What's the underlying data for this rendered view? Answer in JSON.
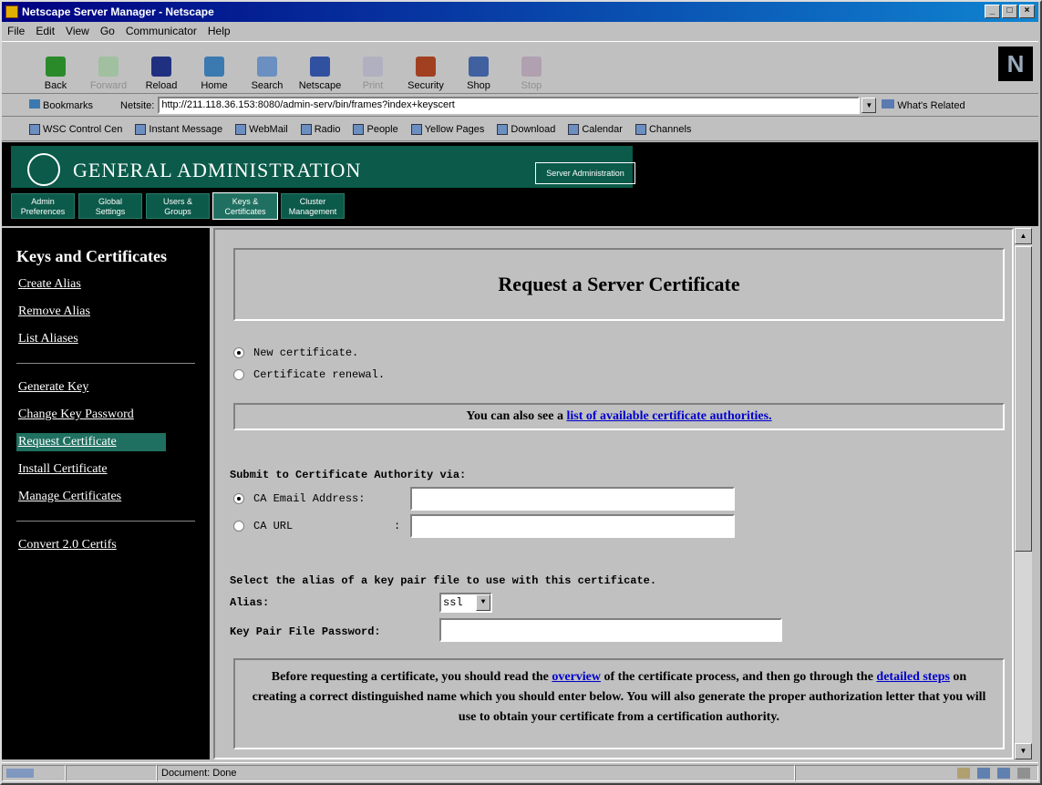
{
  "window": {
    "title": "Netscape Server Manager - Netscape"
  },
  "menu": [
    "File",
    "Edit",
    "View",
    "Go",
    "Communicator",
    "Help"
  ],
  "toolbar": [
    {
      "label": "Back",
      "icon": "back-arrow-icon",
      "color": "#2a8a2a",
      "enabled": true
    },
    {
      "label": "Forward",
      "icon": "forward-arrow-icon",
      "color": "#a0c0a0",
      "enabled": false
    },
    {
      "label": "Reload",
      "icon": "reload-icon",
      "color": "#203080",
      "enabled": true
    },
    {
      "label": "Home",
      "icon": "home-icon",
      "color": "#3a7ab0",
      "enabled": true
    },
    {
      "label": "Search",
      "icon": "search-icon",
      "color": "#6a8fc0",
      "enabled": true
    },
    {
      "label": "Netscape",
      "icon": "netscape-icon",
      "color": "#3050a0",
      "enabled": true
    },
    {
      "label": "Print",
      "icon": "print-icon",
      "color": "#b0b0c0",
      "enabled": false
    },
    {
      "label": "Security",
      "icon": "security-lock-icon",
      "color": "#a04020",
      "enabled": true
    },
    {
      "label": "Shop",
      "icon": "shop-icon",
      "color": "#4060a0",
      "enabled": true
    },
    {
      "label": "Stop",
      "icon": "stop-icon",
      "color": "#b0a0b0",
      "enabled": false
    }
  ],
  "location": {
    "bookmarks_label": "Bookmarks",
    "field_label": "Netsite:",
    "url": "http://211.118.36.153:8080/admin-serv/bin/frames?index+keyscert",
    "whats_related": "What's Related"
  },
  "personal_bar": [
    "WSC Control Cen",
    "Instant Message",
    "WebMail",
    "Radio",
    "People",
    "Yellow Pages",
    "Download",
    "Calendar",
    "Channels"
  ],
  "banner": {
    "title": "GENERAL ADMINISTRATION",
    "server_admin": "Server Administration",
    "tabs": [
      {
        "line1": "Admin",
        "line2": "Preferences",
        "active": false
      },
      {
        "line1": "Global",
        "line2": "Settings",
        "active": false
      },
      {
        "line1": "Users &",
        "line2": "Groups",
        "active": false
      },
      {
        "line1": "Keys &",
        "line2": "Certificates",
        "active": true
      },
      {
        "line1": "Cluster",
        "line2": "Management",
        "active": false
      }
    ]
  },
  "sidebar": {
    "heading": "Keys and Certificates",
    "group1": [
      "Create Alias",
      "Remove Alias",
      "List Aliases"
    ],
    "group2": [
      "Generate Key",
      "Change Key Password",
      "Request Certificate",
      "Install Certificate",
      "Manage Certificates"
    ],
    "group3": [
      "Convert 2.0 Certifs"
    ],
    "selected": "Request Certificate"
  },
  "content": {
    "title": "Request a Server Certificate",
    "cert_type": {
      "new": "New certificate.",
      "renewal": "Certificate renewal.",
      "selected": "new"
    },
    "also_prefix": "You can also see a ",
    "also_link": "list of available certificate authorities.",
    "submit_label": "Submit to Certificate Authority via:",
    "email_label": "CA Email Address:",
    "url_label": "CA URL",
    "url_colon": ":",
    "submit_selected": "email",
    "alias_intro": "Select the alias of a key pair file to use with this certificate.",
    "alias_label": "Alias:",
    "alias_value": "ssl",
    "password_label": "Key Pair File Password:",
    "info_1": "Before requesting a certificate, you should read the ",
    "info_link1": "overview",
    "info_2": " of the certificate process, and then go through the ",
    "info_link2": "detailed steps",
    "info_3": " on creating a correct distinguished name which you should enter below. You will also generate the proper authorization letter that you will use to obtain your certificate from a certification authority."
  },
  "status": {
    "text": "Document: Done"
  }
}
